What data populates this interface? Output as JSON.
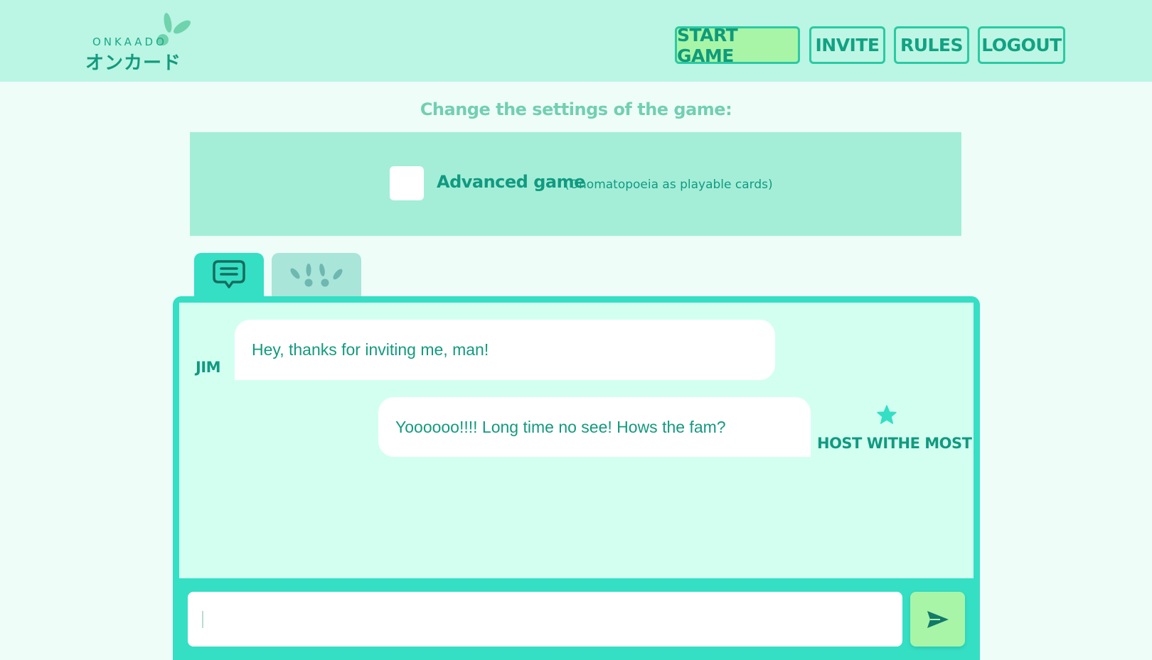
{
  "app": {
    "logo_text": "ONKAADO",
    "logo_jp": "オンカード"
  },
  "nav": {
    "start_game": "START GAME",
    "invite": "INVITE",
    "rules": "RULES",
    "logout": "LOGOUT"
  },
  "settings": {
    "title": "Change the settings of the game:",
    "advanced_label": "Advanced game",
    "advanced_sub": "(Onomatopoeia as playable cards)",
    "advanced_checked": false
  },
  "tabs": [
    {
      "name": "chat",
      "icon": "chat-bubble-icon",
      "active": true
    },
    {
      "name": "game",
      "icon": "bunny-ears-icon",
      "active": false
    }
  ],
  "chat": {
    "messages": [
      {
        "sender": "JIM",
        "text": "Hey, thanks for inviting me, man!",
        "side": "left"
      },
      {
        "sender": "HOST WITHE MOST",
        "text": "Yoooooo!!!! Long time no see! Hows the fam?",
        "side": "right",
        "host": true
      }
    ],
    "input_value": "",
    "input_placeholder": ""
  },
  "colors": {
    "header_bg": "#bbf5e3",
    "page_bg": "#eefdf8",
    "accent": "#34dfc4",
    "text_dark": "#119a80",
    "button_primary": "#a8f5a8",
    "panel": "#a4eed8",
    "chat_bg": "#d3fff1"
  }
}
